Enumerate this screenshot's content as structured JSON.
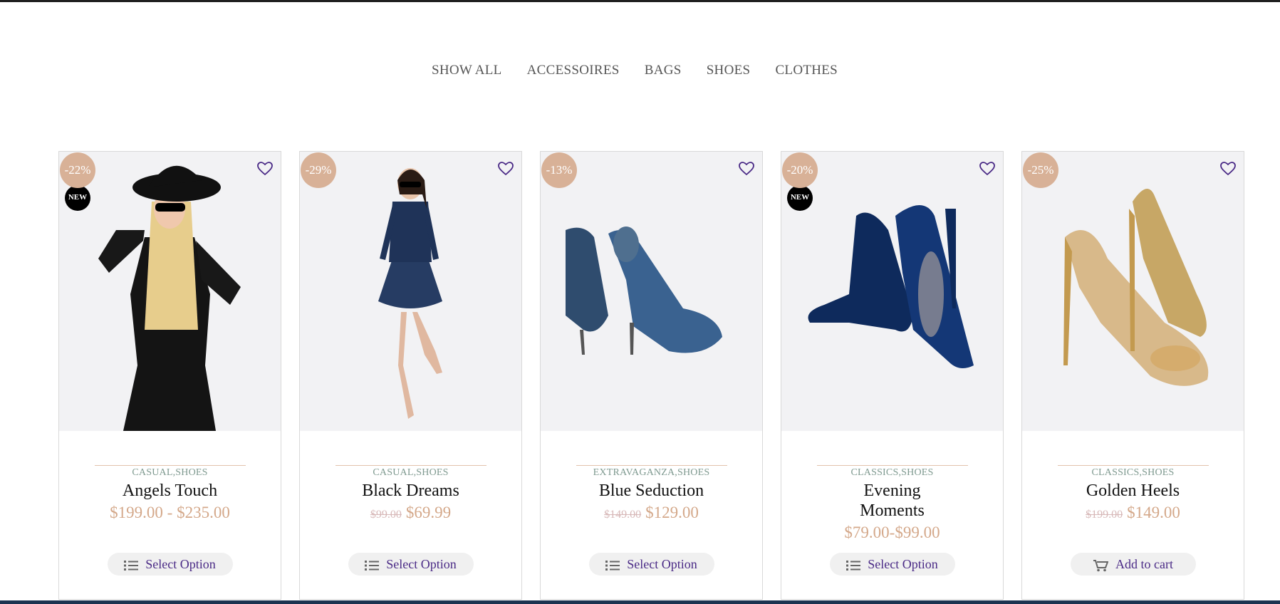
{
  "filters": [
    "SHOW ALL",
    "ACCESSOIRES",
    "BAGS",
    "SHOES",
    "CLOTHES"
  ],
  "products": [
    {
      "discount": "-22%",
      "new_badge": "NEW",
      "categories": "CASUAL,SHOES",
      "title": "Angels Touch",
      "price_range": "$199.00 -  $235.00",
      "button": "Select Option",
      "button_icon": "list-icon"
    },
    {
      "discount": "-29%",
      "categories": "CASUAL,SHOES",
      "title": "Black Dreams",
      "old_price": "$99.00",
      "new_price": "$69.99",
      "button": "Select Option",
      "button_icon": "list-icon"
    },
    {
      "discount": "-13%",
      "categories": "EXTRAVAGANZA,SHOES",
      "title": "Blue Seduction",
      "old_price": "$149.00",
      "new_price": "$129.00",
      "button": "Select Option",
      "button_icon": "list-icon"
    },
    {
      "discount": "-20%",
      "new_badge": "NEW",
      "categories": "CLASSICS,SHOES",
      "title": "Evening Moments",
      "price_range": "$79.00-$99.00",
      "button": "Select Option",
      "button_icon": "list-icon"
    },
    {
      "discount": "-25%",
      "categories": "CLASSICS,SHOES",
      "title": "Golden Heels",
      "old_price": "$199.00",
      "new_price": "$149.00",
      "button": "Add to cart",
      "button_icon": "cart-icon"
    }
  ],
  "colors": {
    "badge": "#d8b197",
    "heart": "#4a2a86",
    "price": "#d4a88a",
    "button_text": "#4a2a86"
  }
}
